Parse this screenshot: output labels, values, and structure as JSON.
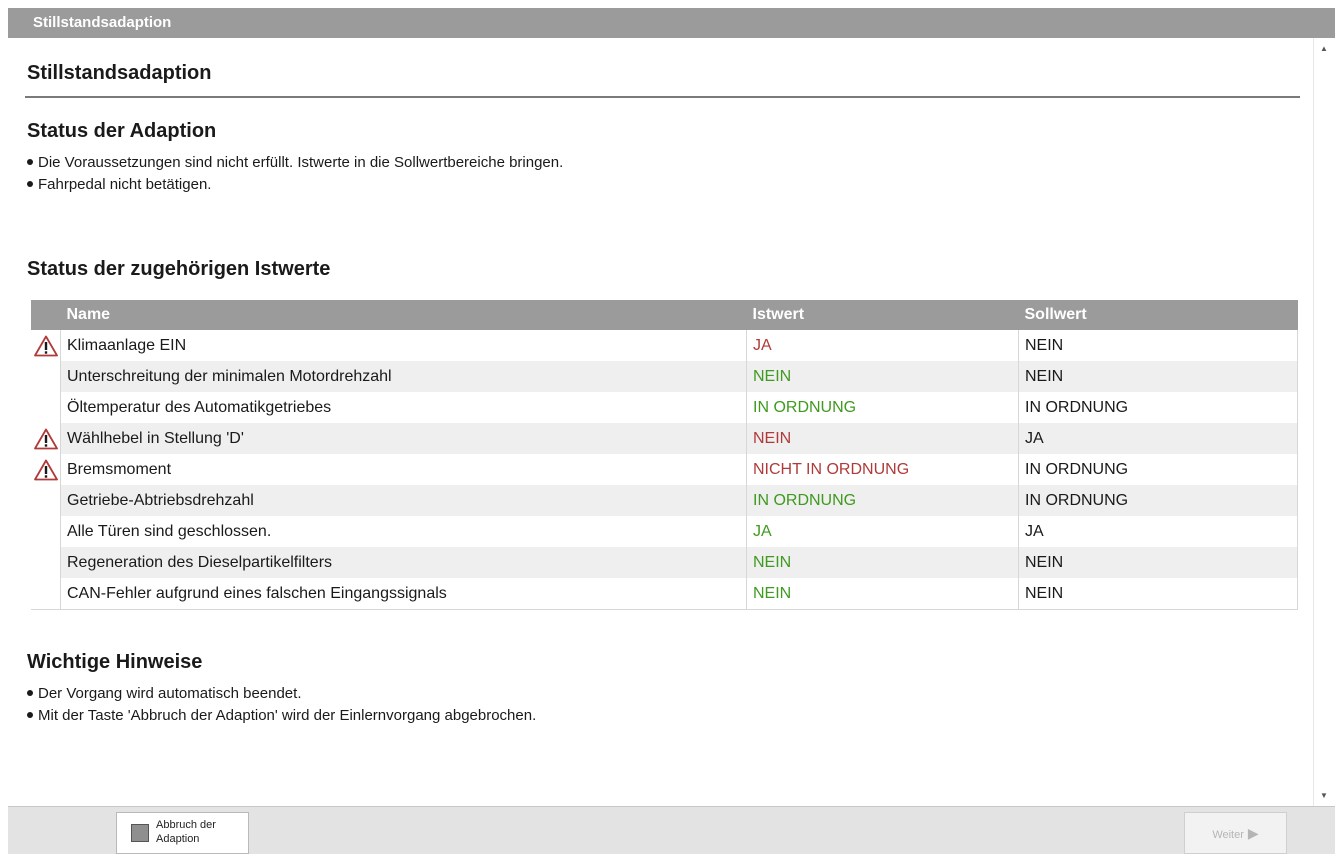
{
  "window": {
    "title": "Stillstandsadaption"
  },
  "page": {
    "title": "Stillstandsadaption"
  },
  "status_section": {
    "heading": "Status der Adaption",
    "bullets": [
      "Die Voraussetzungen sind nicht erfüllt. Istwerte in die Sollwertbereiche bringen.",
      "Fahrpedal nicht betätigen."
    ]
  },
  "values_section": {
    "heading": "Status der zugehörigen Istwerte",
    "columns": {
      "name": "Name",
      "actual": "Istwert",
      "target": "Sollwert"
    },
    "rows": [
      {
        "warning": true,
        "name": "Klimaanlage EIN",
        "actual": "JA",
        "target": "NEIN",
        "status": "error"
      },
      {
        "warning": false,
        "name": "Unterschreitung der minimalen Motordrehzahl",
        "actual": "NEIN",
        "target": "NEIN",
        "status": "ok"
      },
      {
        "warning": false,
        "name": "Öltemperatur des Automatikgetriebes",
        "actual": "IN ORDNUNG",
        "target": "IN ORDNUNG",
        "status": "ok"
      },
      {
        "warning": true,
        "name": "Wählhebel in Stellung 'D'",
        "actual": "NEIN",
        "target": "JA",
        "status": "error"
      },
      {
        "warning": true,
        "name": "Bremsmoment",
        "actual": "NICHT IN ORDNUNG",
        "target": "IN ORDNUNG",
        "status": "error"
      },
      {
        "warning": false,
        "name": "Getriebe-Abtriebsdrehzahl",
        "actual": "IN ORDNUNG",
        "target": "IN ORDNUNG",
        "status": "ok"
      },
      {
        "warning": false,
        "name": "Alle Türen sind geschlossen.",
        "actual": "JA",
        "target": "JA",
        "status": "ok"
      },
      {
        "warning": false,
        "name": "Regeneration des Dieselpartikelfilters",
        "actual": "NEIN",
        "target": "NEIN",
        "status": "ok"
      },
      {
        "warning": false,
        "name": "CAN-Fehler aufgrund eines falschen Eingangssignals",
        "actual": "NEIN",
        "target": "NEIN",
        "status": "ok"
      }
    ]
  },
  "notes_section": {
    "heading": "Wichtige Hinweise",
    "bullets": [
      "Der Vorgang wird automatisch beendet.",
      "Mit der Taste 'Abbruch der Adaption' wird der Einlernvorgang abgebrochen."
    ]
  },
  "footer": {
    "abort_line1": "Abbruch der",
    "abort_line2": "Adaption",
    "next_label": "Weiter"
  },
  "icons": {
    "warning": "warning-triangle-icon",
    "next": "play-arrow-icon",
    "abort": "stop-square-icon"
  },
  "colors": {
    "error": "#b03a3a",
    "ok": "#3f9a1f",
    "header_bar": "#9b9b9b"
  }
}
